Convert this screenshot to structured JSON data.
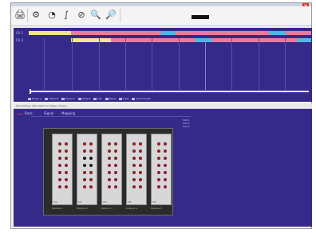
{
  "colors": {
    "timeline_bg": "#352a8a",
    "yellow": "#f0e68c",
    "pink": "#e87ba0",
    "cyan": "#4fb7e8",
    "led_red": "#8c1f2a",
    "led_dark": "#1a1a1a"
  },
  "toolbar": {
    "buttons": [
      {
        "name": "print-icon",
        "glyph": "🖨"
      },
      {
        "name": "settings-icon",
        "glyph": "⚙"
      },
      {
        "name": "chart-icon",
        "glyph": "◔"
      },
      {
        "name": "phase-icon",
        "glyph": "∫"
      },
      {
        "name": "stop-icon",
        "glyph": "⊘"
      },
      {
        "name": "search-icon",
        "glyph": "🔍"
      },
      {
        "name": "zoom-icon",
        "glyph": "🔎"
      }
    ]
  },
  "timeline": {
    "rows": [
      {
        "label": "Ch 1",
        "segments": [
          {
            "color": "yellow",
            "start": 0.0,
            "end": 0.15
          },
          {
            "color": "pink",
            "start": 0.15,
            "end": 0.47
          },
          {
            "color": "cyan",
            "start": 0.47,
            "end": 0.52
          },
          {
            "color": "pink",
            "start": 0.52,
            "end": 0.85
          },
          {
            "color": "cyan",
            "start": 0.85,
            "end": 0.91
          },
          {
            "color": "pink",
            "start": 0.91,
            "end": 1.0
          }
        ]
      },
      {
        "label": "Ch 2",
        "segments": [
          {
            "color": "yellow",
            "start": 0.15,
            "end": 0.29
          },
          {
            "color": "pink",
            "start": 0.29,
            "end": 0.59
          },
          {
            "color": "cyan",
            "start": 0.59,
            "end": 0.65
          },
          {
            "color": "pink",
            "start": 0.65,
            "end": 0.95
          },
          {
            "color": "cyan",
            "start": 0.95,
            "end": 1.0
          }
        ]
      }
    ],
    "legend": [
      "Phase A",
      "Phase B",
      "Phase C",
      "Output",
      "Idle",
      "Reset",
      "Fault",
      "Synchronize"
    ]
  },
  "status": {
    "text": "Zone Status: Idle | Wait for Trigger | Ready"
  },
  "lower": {
    "tabs": [
      "Rack",
      "Signal",
      "Mapping"
    ],
    "info": [
      "Slot 1",
      "Slot 2",
      "Slot 3"
    ],
    "modules": [
      {
        "label": "M1",
        "caption": "Module 1",
        "pattern": [
          "red",
          "red",
          "red",
          "red",
          "red",
          "red",
          "red",
          "red",
          "red",
          "red",
          "red",
          "red",
          "red",
          "red"
        ]
      },
      {
        "label": "M2",
        "caption": "Module 2",
        "pattern": [
          "red",
          "red",
          "red",
          "red",
          "dark",
          "dark",
          "dark",
          "dark",
          "red",
          "red",
          "red",
          "red",
          "red",
          "red"
        ]
      },
      {
        "label": "M3",
        "caption": "Module 3",
        "pattern": [
          "red",
          "red",
          "red",
          "red",
          "red",
          "red",
          "red",
          "red",
          "red",
          "red",
          "red",
          "red",
          "red",
          "red"
        ]
      },
      {
        "label": "M4",
        "caption": "Module 4",
        "pattern": [
          "red",
          "red",
          "red",
          "red",
          "red",
          "red",
          "red",
          "red",
          "red",
          "red",
          "red",
          "red",
          "red",
          "red"
        ]
      },
      {
        "label": "M5",
        "caption": "Module 5",
        "pattern": [
          "red",
          "red",
          "red",
          "red",
          "red",
          "red",
          "red",
          "red",
          "red",
          "red",
          "red",
          "red",
          "red",
          "red"
        ]
      }
    ]
  }
}
